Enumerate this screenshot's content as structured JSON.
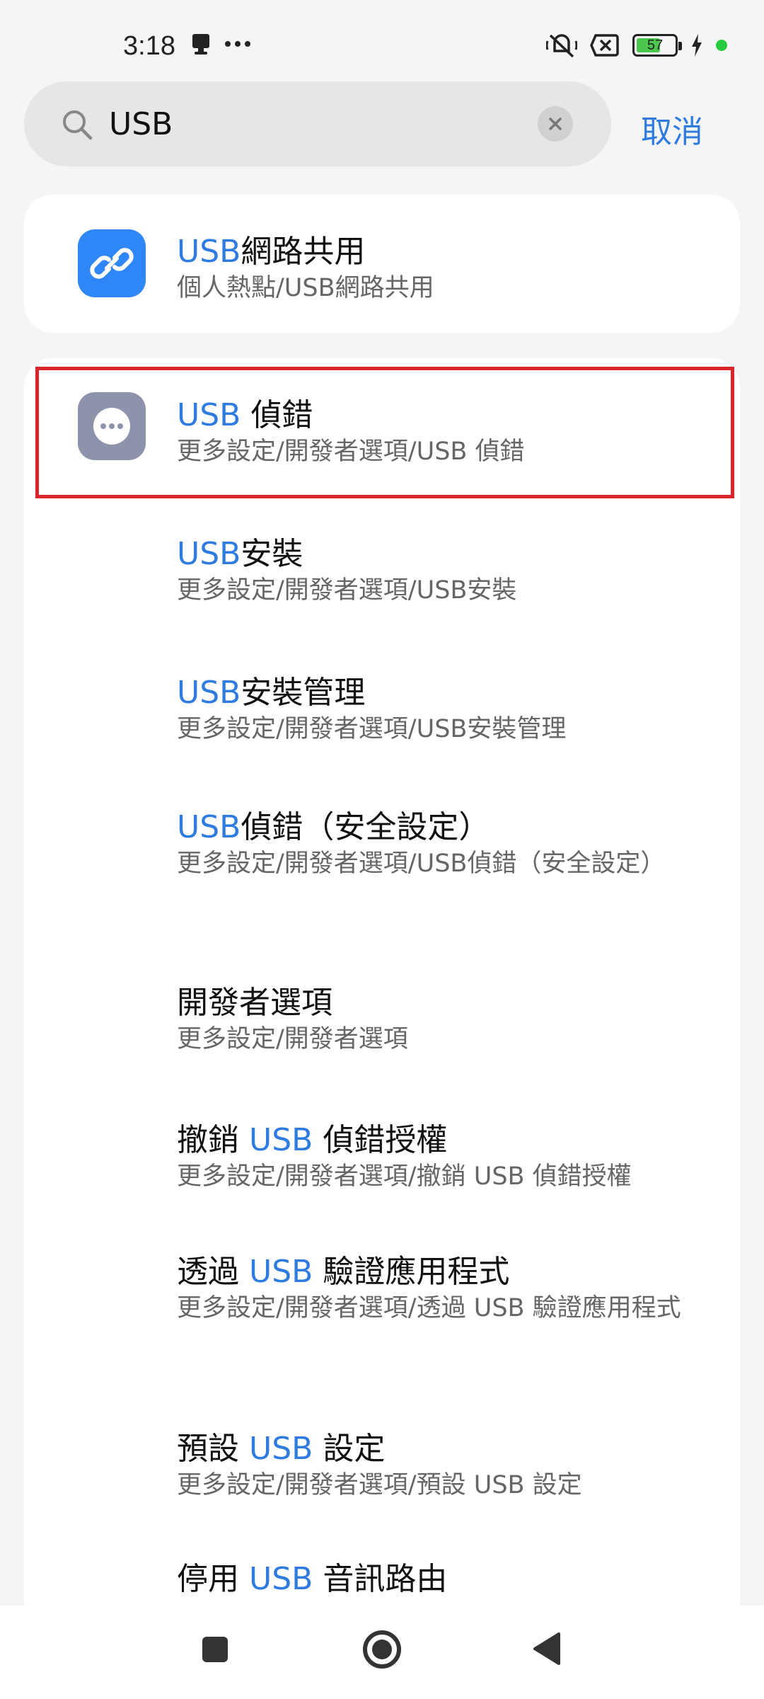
{
  "status_bar": {
    "time": "3:18",
    "battery": "57",
    "icons": [
      "notification-icon",
      "more-icon",
      "mute-icon",
      "no-sim-icon",
      "battery-icon",
      "charging-icon",
      "green-dot"
    ]
  },
  "search": {
    "query": "USB",
    "cancel_label": "取消"
  },
  "results": [
    {
      "icon": "link-icon",
      "highlight": "USB",
      "rest": "網路共用",
      "subtitle": "個人熱點/USB網路共用"
    },
    {
      "icon": "more-dots-icon",
      "highlight": "USB",
      "rest": " 偵錯",
      "subtitle": "更多設定/開發者選項/USB 偵錯"
    },
    {
      "highlight": "USB",
      "rest": "安裝",
      "subtitle": "更多設定/開發者選項/USB安裝"
    },
    {
      "highlight": "USB",
      "rest": "安裝管理",
      "subtitle": "更多設定/開發者選項/USB安裝管理"
    },
    {
      "highlight": "USB",
      "rest": "偵錯（安全設定）",
      "subtitle": "更多設定/開發者選項/USB偵錯（安全設定）"
    },
    {
      "prefix": "開發者選項",
      "subtitle": "更多設定/開發者選項"
    },
    {
      "prefix": "撤銷 ",
      "highlight": "USB",
      "rest": " 偵錯授權",
      "subtitle": "更多設定/開發者選項/撤銷 USB 偵錯授權"
    },
    {
      "prefix": "透過 ",
      "highlight": "USB",
      "rest": " 驗證應用程式",
      "subtitle": "更多設定/開發者選項/透過 USB 驗證應用程式"
    },
    {
      "prefix": "預設 ",
      "highlight": "USB",
      "rest": " 設定",
      "subtitle": "更多設定/開發者選項/預設 USB 設定"
    },
    {
      "prefix": "停用 ",
      "highlight": "USB",
      "rest": " 音訊路由"
    }
  ],
  "colors": {
    "accent": "#2f7ce0",
    "selection_border": "#d9262c",
    "link_icon_bg": "#2f86f6",
    "dev_icon_bg": "#8c93ab"
  }
}
